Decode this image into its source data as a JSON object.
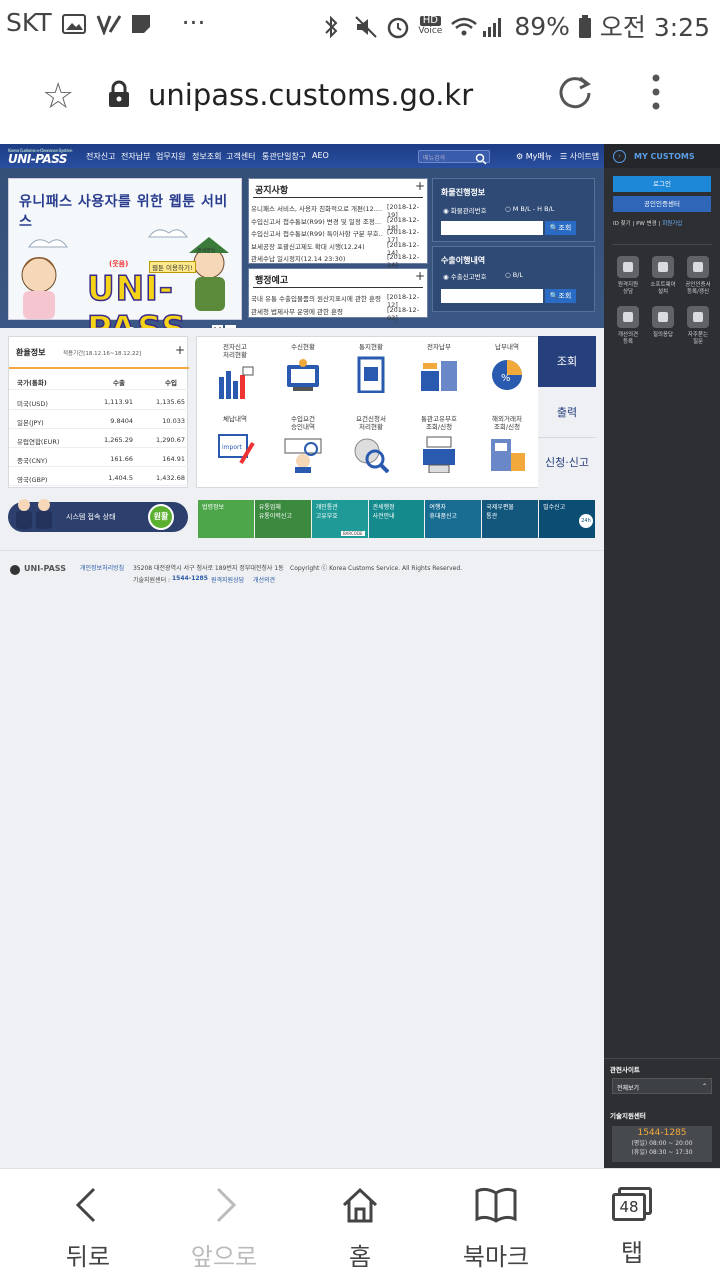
{
  "status_bar": {
    "carrier": "SKT",
    "dots": "···",
    "battery": "89%",
    "time": "오전 3:25",
    "hd_label": "HD",
    "voice_label": "Voice"
  },
  "browser": {
    "url": "unipass.customs.go.kr"
  },
  "site": {
    "logo": "UNI-PASS",
    "logo_sub": "Korea Customs e-Clearance System",
    "nav": [
      "전자신고",
      "전자납부",
      "업무지원",
      "정보조회",
      "고객센터",
      "통관단일창구",
      "AEO"
    ],
    "search_placeholder": "메뉴검색",
    "my_menu": "My메뉴",
    "sitemap": "사이트맵",
    "banner": {
      "title": "유니패스 사용자를 위한 웹툰 서비스",
      "logo_text": "UNI-PASS",
      "tag_left": "(웃음)",
      "tag_right": "웹툰 이용하기!",
      "tag_char": "관세맘님"
    },
    "notice": {
      "title": "공지사항",
      "items": [
        {
          "text": "유니패스 서비스, 사용자 친화적으로 개편(12....",
          "date": "[2018-12-19]"
        },
        {
          "text": "수입신고서 접수통보(R99) 변경 및 일정 조정...",
          "date": "[2018-12-18]"
        },
        {
          "text": "수입신고서 접수통보(R99) 특이사항 구분 부호...",
          "date": "[2018-12-17]"
        },
        {
          "text": "보세공장 포괄신고제도 확대 시행(12.24)",
          "date": "[2018-12-14]"
        },
        {
          "text": "관세수납 일시정지(12.14 23:30)",
          "date": "[2018-12-14]"
        }
      ]
    },
    "admin_notice": {
      "title": "행정예고",
      "items": [
        {
          "text": "국내 유통 수출입물품의 원산지표시에 관한 훈령",
          "date": "[2018-12-12]"
        },
        {
          "text": "관세청 법제사무 운영에 관한 훈령",
          "date": "[2018-12-03]"
        }
      ]
    },
    "cargo": {
      "title": "화물진행정보",
      "opt1": "화물관리번호",
      "opt2": "M B/L - H B/L",
      "button": "조회"
    },
    "export": {
      "title": "수출이행내역",
      "opt1": "수출신고번호",
      "opt2": "B/L",
      "button": "조회"
    },
    "rates": {
      "title": "환율정보",
      "period": "적용기간[18.12.16~18.12.22]",
      "headers": [
        "국가(통화)",
        "수출",
        "수입"
      ],
      "rows": [
        [
          "미국(USD)",
          "1,113.91",
          "1,135.65"
        ],
        [
          "일본(JPY)",
          "9.8404",
          "10.033"
        ],
        [
          "유럽연합(EUR)",
          "1,265.29",
          "1,290.67"
        ],
        [
          "중국(CNY)",
          "161.66",
          "164.91"
        ],
        [
          "영국(GBP)",
          "1,404.5",
          "1,432.68"
        ]
      ]
    },
    "services": [
      {
        "l1": "전자신고",
        "l2": "처리현황"
      },
      {
        "l1": "수신현황",
        "l2": ""
      },
      {
        "l1": "통지현황",
        "l2": ""
      },
      {
        "l1": "전자납부",
        "l2": ""
      },
      {
        "l1": "납부내역",
        "l2": ""
      },
      {
        "l1": "체납내역",
        "l2": ""
      },
      {
        "l1": "수입요건",
        "l2": "승인내역"
      },
      {
        "l1": "요건신청서",
        "l2": "처리현황"
      },
      {
        "l1": "통관고유부호",
        "l2": "조회/신청"
      },
      {
        "l1": "해외거래처",
        "l2": "조회/신청"
      }
    ],
    "side_tabs": [
      "조회",
      "출력",
      "신청·신고"
    ],
    "system_status": {
      "label": "시스템 접속 상태",
      "value": "원활"
    },
    "quick": [
      {
        "l1": "법령정보",
        "l2": ""
      },
      {
        "l1": "유통업체",
        "l2": "유통이력신고"
      },
      {
        "l1": "개인통관",
        "l2": "고유부호"
      },
      {
        "l1": "관세행정",
        "l2": "사전안내"
      },
      {
        "l1": "여행자",
        "l2": "휴대품신고"
      },
      {
        "l1": "국제우편물",
        "l2": "통관"
      },
      {
        "l1": "밀수신고",
        "l2": ""
      }
    ],
    "quick_badge": "24h",
    "quick_barcode": "BARCODE",
    "footer": {
      "logo": "UNI-PASS",
      "privacy": "개인정보처리방침",
      "address": "35208 대전광역시 서구 청사로 189번지 정부대전청사 1동",
      "copyright": "Copyright ⓒ Korea Customs Service. All Rights Reserved.",
      "support_label": "기술지원센터 :",
      "support_phone": "1544-1285",
      "remote": "원격지원상담",
      "suggest": "개선의견"
    }
  },
  "my_customs": {
    "title": "MY CUSTOMS",
    "login": "로그인",
    "cert": "공인인증센터",
    "links": [
      "ID 찾기",
      "PW 변경",
      "회원가입"
    ],
    "icons": [
      {
        "l1": "원격지원",
        "l2": "상담"
      },
      {
        "l1": "소프트웨어",
        "l2": "설치"
      },
      {
        "l1": "공인인증서",
        "l2": "등록/갱신"
      },
      {
        "l1": "개선의견",
        "l2": "등록"
      },
      {
        "l1": "질의응답",
        "l2": ""
      },
      {
        "l1": "자주묻는",
        "l2": "질문"
      }
    ],
    "related": "관련사이트",
    "view_all": "전체보기",
    "support_title": "기술지원센터",
    "support_phone": "1544-1285",
    "weekday": "(평일) 08:00 ~ 20:00",
    "holiday": "(휴일) 08:30 ~ 17:30"
  },
  "bottom_nav": [
    {
      "label": "뒤로"
    },
    {
      "label": "앞으로"
    },
    {
      "label": "홈"
    },
    {
      "label": "북마크"
    },
    {
      "label": "탭",
      "count": "48"
    }
  ]
}
